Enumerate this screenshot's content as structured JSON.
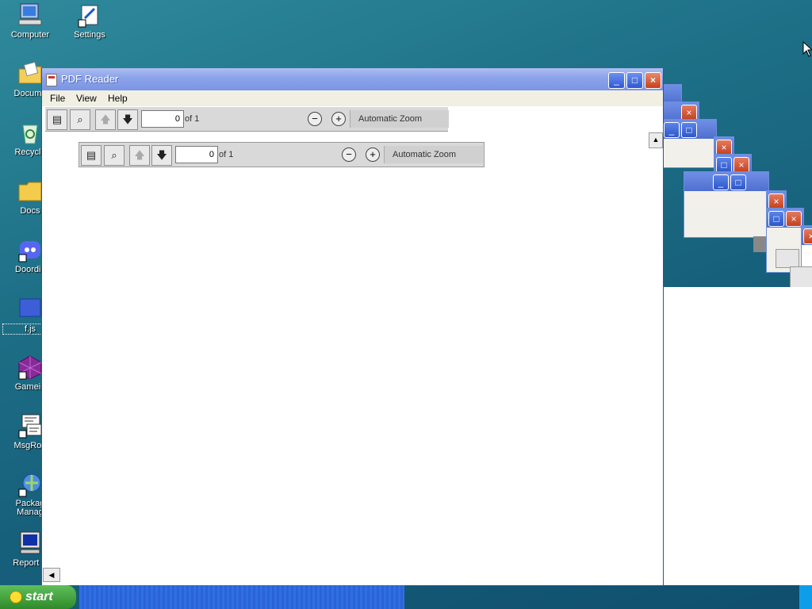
{
  "desktop": {
    "icons": [
      {
        "label": "Computer"
      },
      {
        "label": "Settings"
      },
      {
        "label": "Docume"
      },
      {
        "label": "Recycle"
      },
      {
        "label": "Docs"
      },
      {
        "label": "Doordis"
      },
      {
        "label": "f.js"
      },
      {
        "label": "Gamein"
      },
      {
        "label": "MsgRoo"
      },
      {
        "label": "Packag\nManag"
      },
      {
        "label": "Report E"
      }
    ]
  },
  "window": {
    "title": "PDF Reader",
    "menu": [
      "File",
      "View",
      "Help"
    ],
    "toolbar": {
      "page_value": "0",
      "page_of": "of 1",
      "zoom_label": "Automatic Zoom"
    },
    "toolbar_nested": {
      "page_value": "0",
      "page_of": "of 1",
      "zoom_label": "Automatic Zoom"
    }
  },
  "taskbar": {
    "start_label": "start"
  },
  "colors": {
    "desktop_bg": "#1d6f86",
    "titlebar": "#8ea4ea",
    "start_green": "#3fa13a",
    "taskbar_blue": "#2f6fe4"
  }
}
